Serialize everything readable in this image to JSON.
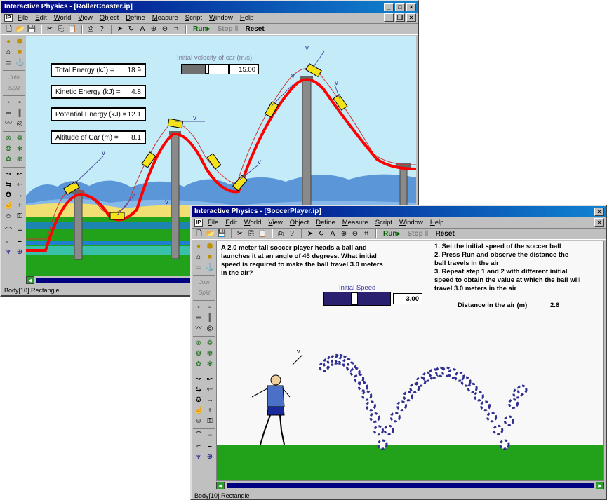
{
  "windows": {
    "roller": {
      "title": "Interactive Physics - [RollerCoaster.ip]",
      "menu": [
        "File",
        "Edit",
        "World",
        "View",
        "Object",
        "Define",
        "Measure",
        "Script",
        "Window",
        "Help"
      ],
      "toolbar": {
        "run": "Run▸",
        "stop": "Stop ‖",
        "reset": "Reset"
      },
      "palette_words": {
        "join": "Join",
        "split": "Split"
      },
      "meters": [
        {
          "label": "Total Energy (kJ) =",
          "value": "18.9"
        },
        {
          "label": "Kinetic Energy (kJ) =",
          "value": "4.8"
        },
        {
          "label": "Potential Energy (kJ) =",
          "value": "12.1"
        },
        {
          "label": "Altitude of Car (m) =",
          "value": "8.1"
        }
      ],
      "slider": {
        "label": "Initial velocity of car (m/s)",
        "value": "15.00",
        "level": 0.5
      },
      "vector_label": "v",
      "status": "Body[10] Rectangle"
    },
    "soccer": {
      "title": "Interactive Physics - [SoccerPlayer.ip]",
      "menu": [
        "File",
        "Edit",
        "World",
        "View",
        "Object",
        "Define",
        "Measure",
        "Script",
        "Window",
        "Help"
      ],
      "toolbar": {
        "run": "Run▸",
        "stop": "Stop ‖",
        "reset": "Reset"
      },
      "palette_words": {
        "join": "Join",
        "split": "Split"
      },
      "problem": "A 2.0 meter tall soccer player heads a ball and launches it at an angle of 45 degrees. What initial speed is required to make the ball travel 3.0 meters in the air?",
      "instructions": [
        "1. Set the initial speed of the soccer ball",
        "2. Press Run and observe the distance the ball travels in the air",
        "3. Repeat step 1 and 2 with different initial speed to obtain the value at which the ball will travel 3.0 meters in the air"
      ],
      "slider": {
        "label": "Initial Speed",
        "value": "3.00",
        "level": 0.4
      },
      "distance": {
        "label": "Distance in the air (m)",
        "value": "2.6"
      },
      "vector_label": "v",
      "status": "Body[10] Rectangle"
    }
  },
  "colors": {
    "track": "#ff0000",
    "ground": "#22a21b",
    "sky": "#c4ecf8",
    "ball": "#303090",
    "slider": "#2a2070"
  }
}
